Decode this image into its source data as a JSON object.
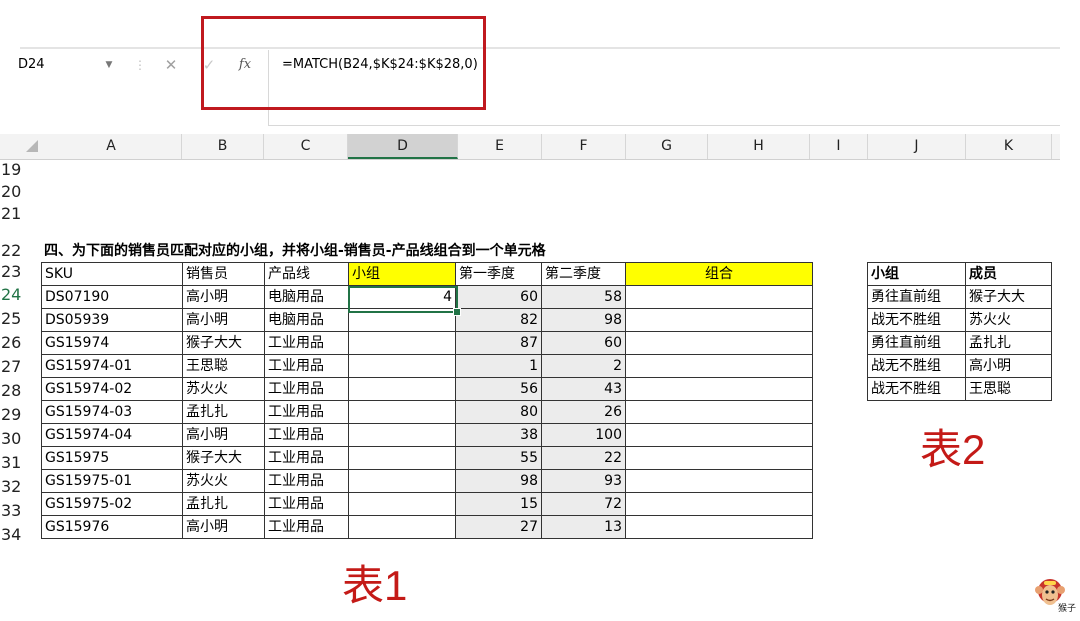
{
  "name_box": {
    "value": "D24"
  },
  "formula_bar": {
    "cancel_icon": "close-icon",
    "enter_icon": "check-icon",
    "fx_label": "fx",
    "formula": "=MATCH(B24,$K$24:$K$28,0)"
  },
  "columns": [
    "A",
    "B",
    "C",
    "D",
    "E",
    "F",
    "G",
    "H",
    "I",
    "J",
    "K"
  ],
  "selected_column": "D",
  "rows": [
    "19",
    "20",
    "21",
    "22",
    "23",
    "24",
    "25",
    "26",
    "27",
    "28",
    "29",
    "30",
    "31",
    "32",
    "33",
    "34"
  ],
  "selected_row": "24",
  "sheet_title": "四、为下面的销售员匹配对应的小组，并将小组-销售员-产品线组合到一个单元格",
  "table1": {
    "headers": [
      "SKU",
      "销售员",
      "产品线",
      "小组",
      "第一季度",
      "第二季度",
      "组合"
    ],
    "rows": [
      [
        "DS07190",
        "高小明",
        "电脑用品",
        "4",
        "60",
        "58",
        ""
      ],
      [
        "DS05939",
        "高小明",
        "电脑用品",
        "",
        "82",
        "98",
        ""
      ],
      [
        "GS15974",
        "猴子大大",
        "工业用品",
        "",
        "87",
        "60",
        ""
      ],
      [
        "GS15974-01",
        "王思聪",
        "工业用品",
        "",
        "1",
        "2",
        ""
      ],
      [
        "GS15974-02",
        "苏火火",
        "工业用品",
        "",
        "56",
        "43",
        ""
      ],
      [
        "GS15974-03",
        "孟扎扎",
        "工业用品",
        "",
        "80",
        "26",
        ""
      ],
      [
        "GS15974-04",
        "高小明",
        "工业用品",
        "",
        "38",
        "100",
        ""
      ],
      [
        "GS15975",
        "猴子大大",
        "工业用品",
        "",
        "55",
        "22",
        ""
      ],
      [
        "GS15975-01",
        "苏火火",
        "工业用品",
        "",
        "98",
        "93",
        ""
      ],
      [
        "GS15975-02",
        "孟扎扎",
        "工业用品",
        "",
        "15",
        "72",
        ""
      ],
      [
        "GS15976",
        "高小明",
        "工业用品",
        "",
        "27",
        "13",
        ""
      ]
    ]
  },
  "table2": {
    "headers": [
      "小组",
      "成员"
    ],
    "rows": [
      [
        "勇往直前组",
        "猴子大大"
      ],
      [
        "战无不胜组",
        "苏火火"
      ],
      [
        "勇往直前组",
        "孟扎扎"
      ],
      [
        "战无不胜组",
        "高小明"
      ],
      [
        "战无不胜组",
        "王思聪"
      ]
    ]
  },
  "labels": {
    "table1": "表1",
    "table2": "表2"
  },
  "logo": {
    "text": "猴子",
    "icon": "monkey-logo-icon"
  },
  "colors": {
    "highlight_box": "#c0191f",
    "label_red": "#c41a17",
    "header_yellow": "#ffff00",
    "excel_green": "#217346"
  }
}
